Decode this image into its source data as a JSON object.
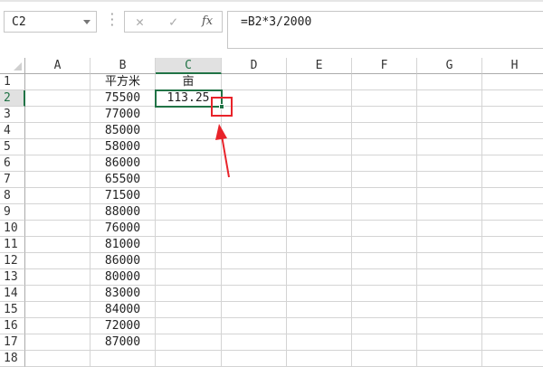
{
  "formula_bar": {
    "name_box": "C2",
    "cancel_icon": "✕",
    "enter_icon": "✓",
    "fx_label": "fx",
    "formula": "=B2*3/2000"
  },
  "columns": [
    "A",
    "B",
    "C",
    "D",
    "E",
    "F",
    "G",
    "H"
  ],
  "selected_column": "C",
  "selected_row": 2,
  "rows": [
    {
      "n": "1",
      "A": "",
      "B": "平方米",
      "C": "亩"
    },
    {
      "n": "2",
      "A": "",
      "B": "75500",
      "C": "113.25"
    },
    {
      "n": "3",
      "A": "",
      "B": "77000",
      "C": ""
    },
    {
      "n": "4",
      "A": "",
      "B": "85000",
      "C": ""
    },
    {
      "n": "5",
      "A": "",
      "B": "58000",
      "C": ""
    },
    {
      "n": "6",
      "A": "",
      "B": "86000",
      "C": ""
    },
    {
      "n": "7",
      "A": "",
      "B": "65500",
      "C": ""
    },
    {
      "n": "8",
      "A": "",
      "B": "71500",
      "C": ""
    },
    {
      "n": "9",
      "A": "",
      "B": "88000",
      "C": ""
    },
    {
      "n": "10",
      "A": "",
      "B": "76000",
      "C": ""
    },
    {
      "n": "11",
      "A": "",
      "B": "81000",
      "C": ""
    },
    {
      "n": "12",
      "A": "",
      "B": "86000",
      "C": ""
    },
    {
      "n": "13",
      "A": "",
      "B": "80000",
      "C": ""
    },
    {
      "n": "14",
      "A": "",
      "B": "83000",
      "C": ""
    },
    {
      "n": "15",
      "A": "",
      "B": "84000",
      "C": ""
    },
    {
      "n": "16",
      "A": "",
      "B": "72000",
      "C": ""
    },
    {
      "n": "17",
      "A": "",
      "B": "87000",
      "C": ""
    },
    {
      "n": "18",
      "A": "",
      "B": "",
      "C": ""
    }
  ],
  "colors": {
    "accent": "#217346",
    "annotation": "#e8232a"
  }
}
